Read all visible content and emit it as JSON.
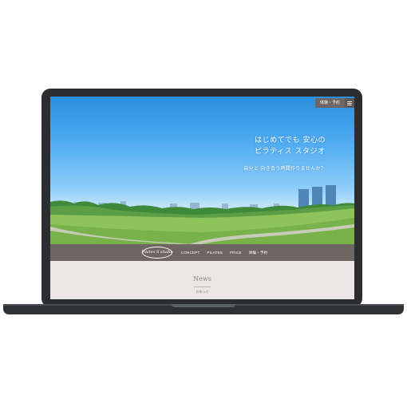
{
  "header": {
    "reserve_label": "体験・予約",
    "menu_icon": "hamburger-menu-icon"
  },
  "hero": {
    "title_line1": "はじめてでも 安心の",
    "title_line2": "ピラティス スタジオ",
    "subtitle": "自分と 向き合う時間作りませんか？"
  },
  "nav": {
    "logo_text": "Pilates S studio",
    "items": [
      {
        "label": "CONCEPT"
      },
      {
        "label": "PILATES"
      },
      {
        "label": "PRICE"
      },
      {
        "label": "体験・予約"
      }
    ]
  },
  "news": {
    "title": "News",
    "subtitle": "お知らせ"
  },
  "colors": {
    "nav_bg": "#6f6664",
    "news_bg": "#eee6e6",
    "laptop_frame": "#2b2d30"
  }
}
